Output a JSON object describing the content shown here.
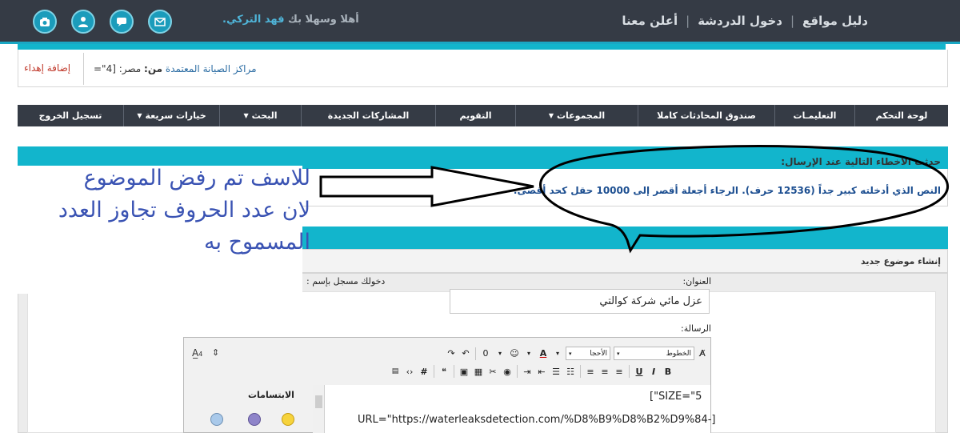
{
  "topbar": {
    "nav": [
      "دليل مواقع",
      "دخول الدردشة",
      "أعلن معنا"
    ],
    "welcome_prefix": "أهلا وسهلا بك",
    "username": "فهد التركي.",
    "icons": [
      "mail-icon",
      "chat-icon",
      "user-icon",
      "camera-icon"
    ]
  },
  "gift": {
    "link": "إضافة إهداء",
    "center": "مراكز الصيانة المعتمدة",
    "from_label": "من:",
    "rest": "مصر: [4\"="
  },
  "navbar": [
    {
      "label": "لوحة التحكم",
      "caret": false
    },
    {
      "label": "التعليمـات",
      "caret": false
    },
    {
      "label": "صندوق المحادثات كاملا",
      "caret": false
    },
    {
      "label": "المجموعات",
      "caret": true
    },
    {
      "label": "التقويم",
      "caret": false
    },
    {
      "label": "المشاركات الجديدة",
      "caret": false
    },
    {
      "label": "البحث",
      "caret": true
    },
    {
      "label": "خيارات سريعة",
      "caret": true
    },
    {
      "label": "تسجيل الخروج",
      "caret": false
    }
  ],
  "errors": {
    "title": "حدثت الأخطاء التالية عند الإرسال:",
    "message": "النص الذي أدخلته كبير جداً (12536 حرف). الرجاء أجعلة أقصر إلى 10000 حقل كحد أقصى."
  },
  "new_topic": {
    "title": "إنشاء موضوع جديد",
    "label_title": "العنوان:",
    "label_login": "دخولك مسجل بإسم :",
    "title_value": "عزل مائي شركة كوالتي",
    "label_message": "الرسالة:"
  },
  "editor": {
    "font_select": "الخطوط",
    "size_select": "الأحجا",
    "smilies_title": "الابتسامات",
    "text_lines": [
      "[\"SIZE=\"5",
      "URL=\"https://waterleaksdetection.com/%D8%B9%D8%B2%D9%84-]"
    ]
  },
  "annotation": {
    "lines": [
      "للاسف تم رفض الموضوع",
      "لان عدد الحروف تجاوز العدد",
      "المسموح به"
    ]
  },
  "colors": {
    "topbar": "#353b45",
    "accent": "#12b5cc",
    "annotation_text": "#3a53b3",
    "error_text": "#1d4f91"
  }
}
